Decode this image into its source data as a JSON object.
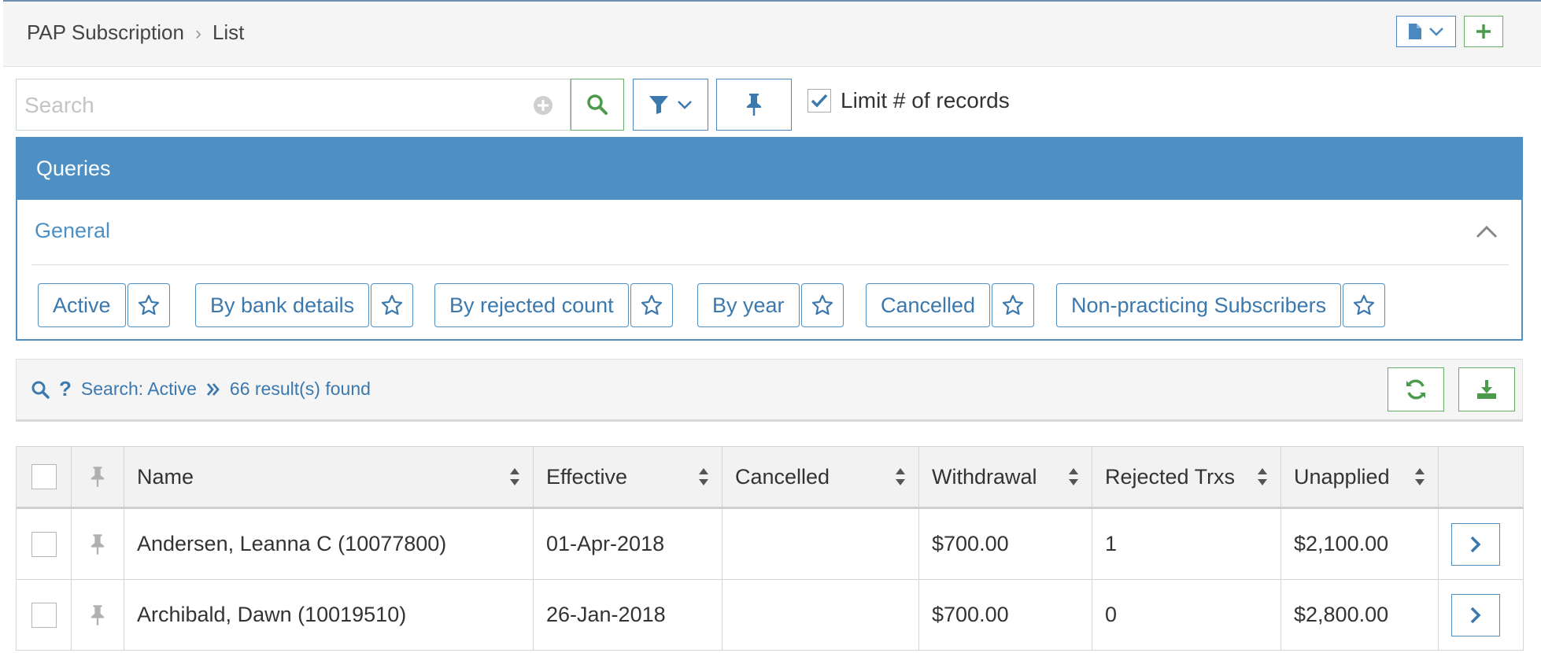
{
  "breadcrumb": {
    "root": "PAP Subscription",
    "current": "List"
  },
  "search": {
    "placeholder": "Search",
    "value": ""
  },
  "limit_records": {
    "label": "Limit # of records",
    "checked": true
  },
  "queries": {
    "title": "Queries",
    "group": "General",
    "items": [
      {
        "label": "Active"
      },
      {
        "label": "By bank details"
      },
      {
        "label": "By rejected count"
      },
      {
        "label": "By year"
      },
      {
        "label": "Cancelled"
      },
      {
        "label": "Non-practicing Subscribers"
      }
    ]
  },
  "results": {
    "search_label": "Search: Active",
    "found": "66 result(s) found"
  },
  "table": {
    "columns": [
      "Name",
      "Effective",
      "Cancelled",
      "Withdrawal",
      "Rejected Trxs",
      "Unapplied"
    ],
    "rows": [
      {
        "name": "Andersen, Leanna C (10077800)",
        "effective": "01-Apr-2018",
        "cancelled": "",
        "withdrawal": "$700.00",
        "rejected": "1",
        "unapplied": "$2,100.00"
      },
      {
        "name": "Archibald, Dawn (10019510)",
        "effective": "26-Jan-2018",
        "cancelled": "",
        "withdrawal": "$700.00",
        "rejected": "0",
        "unapplied": "$2,800.00"
      }
    ]
  },
  "colors": {
    "primary": "#4e90c3",
    "success": "#66ad66",
    "pin_gray": "#b0b0b0"
  },
  "icons": [
    "document-icon",
    "chevron-down-icon",
    "plus-icon",
    "plus-circle-icon",
    "search-icon",
    "filter-icon",
    "pin-icon",
    "check-icon",
    "chevron-up-icon",
    "star-icon",
    "question-icon",
    "double-chevron-right-icon",
    "refresh-icon",
    "download-icon",
    "sort-icon",
    "chevron-right-icon"
  ]
}
